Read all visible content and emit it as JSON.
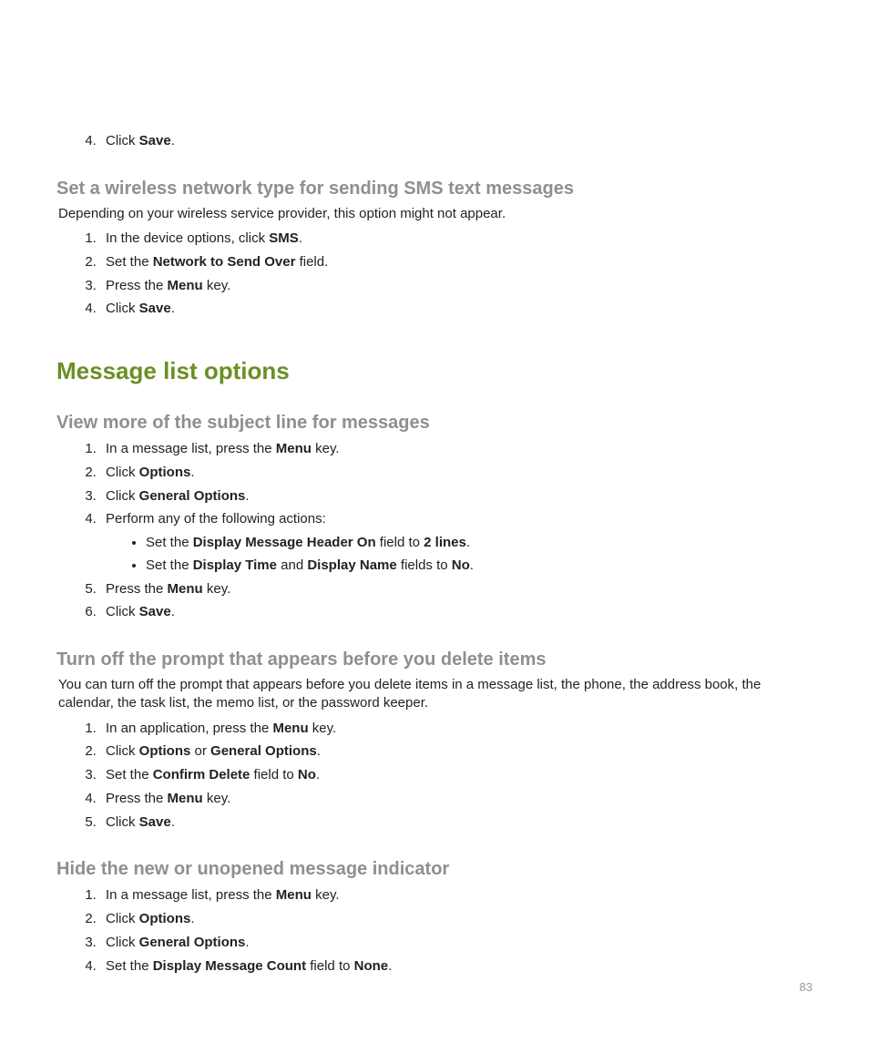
{
  "page_number": "83",
  "intro_step": {
    "num": "4",
    "pre": "Click ",
    "bold": "Save",
    "post": "."
  },
  "sec1": {
    "heading": "Set a wireless network type for sending SMS text messages",
    "lead": "Depending on your wireless service provider, this option might not appear.",
    "steps": [
      {
        "segs": [
          {
            "t": "In the device options, click "
          },
          {
            "t": "SMS",
            "b": true
          },
          {
            "t": "."
          }
        ]
      },
      {
        "segs": [
          {
            "t": "Set the "
          },
          {
            "t": "Network to Send Over",
            "b": true
          },
          {
            "t": " field."
          }
        ]
      },
      {
        "segs": [
          {
            "t": "Press the "
          },
          {
            "t": "Menu",
            "b": true
          },
          {
            "t": " key."
          }
        ]
      },
      {
        "segs": [
          {
            "t": "Click "
          },
          {
            "t": "Save",
            "b": true
          },
          {
            "t": "."
          }
        ]
      }
    ]
  },
  "section_title": "Message list options",
  "sec2": {
    "heading": "View more of the subject line for messages",
    "steps": [
      {
        "segs": [
          {
            "t": "In a message list, press the "
          },
          {
            "t": "Menu",
            "b": true
          },
          {
            "t": " key."
          }
        ]
      },
      {
        "segs": [
          {
            "t": "Click "
          },
          {
            "t": "Options",
            "b": true
          },
          {
            "t": "."
          }
        ]
      },
      {
        "segs": [
          {
            "t": "Click "
          },
          {
            "t": "General Options",
            "b": true
          },
          {
            "t": "."
          }
        ]
      },
      {
        "segs": [
          {
            "t": "Perform any of the following actions:"
          }
        ],
        "bullets": [
          {
            "segs": [
              {
                "t": "Set the "
              },
              {
                "t": "Display Message Header On",
                "b": true
              },
              {
                "t": " field to "
              },
              {
                "t": "2 lines",
                "b": true
              },
              {
                "t": "."
              }
            ]
          },
          {
            "segs": [
              {
                "t": "Set the "
              },
              {
                "t": "Display Time",
                "b": true
              },
              {
                "t": " and "
              },
              {
                "t": "Display Name",
                "b": true
              },
              {
                "t": " fields to "
              },
              {
                "t": "No",
                "b": true
              },
              {
                "t": "."
              }
            ]
          }
        ]
      },
      {
        "segs": [
          {
            "t": "Press the "
          },
          {
            "t": "Menu",
            "b": true
          },
          {
            "t": " key."
          }
        ]
      },
      {
        "segs": [
          {
            "t": "Click "
          },
          {
            "t": "Save",
            "b": true
          },
          {
            "t": "."
          }
        ]
      }
    ]
  },
  "sec3": {
    "heading": "Turn off the prompt that appears before you delete items",
    "lead": "You can turn off the prompt that appears before you delete items in a message list, the phone, the address book, the calendar, the task list, the memo list, or the password keeper.",
    "steps": [
      {
        "segs": [
          {
            "t": "In an application, press the "
          },
          {
            "t": "Menu",
            "b": true
          },
          {
            "t": " key."
          }
        ]
      },
      {
        "segs": [
          {
            "t": "Click "
          },
          {
            "t": "Options",
            "b": true
          },
          {
            "t": " or "
          },
          {
            "t": "General Options",
            "b": true
          },
          {
            "t": "."
          }
        ]
      },
      {
        "segs": [
          {
            "t": "Set the "
          },
          {
            "t": "Confirm Delete",
            "b": true
          },
          {
            "t": " field to "
          },
          {
            "t": "No",
            "b": true
          },
          {
            "t": "."
          }
        ]
      },
      {
        "segs": [
          {
            "t": "Press the "
          },
          {
            "t": "Menu",
            "b": true
          },
          {
            "t": " key."
          }
        ]
      },
      {
        "segs": [
          {
            "t": "Click "
          },
          {
            "t": "Save",
            "b": true
          },
          {
            "t": "."
          }
        ]
      }
    ]
  },
  "sec4": {
    "heading": "Hide the new or unopened message indicator",
    "steps": [
      {
        "segs": [
          {
            "t": "In a message list, press the "
          },
          {
            "t": "Menu",
            "b": true
          },
          {
            "t": " key."
          }
        ]
      },
      {
        "segs": [
          {
            "t": "Click "
          },
          {
            "t": "Options",
            "b": true
          },
          {
            "t": "."
          }
        ]
      },
      {
        "segs": [
          {
            "t": "Click "
          },
          {
            "t": "General Options",
            "b": true
          },
          {
            "t": "."
          }
        ]
      },
      {
        "segs": [
          {
            "t": "Set the "
          },
          {
            "t": "Display Message Count",
            "b": true
          },
          {
            "t": " field to "
          },
          {
            "t": "None",
            "b": true
          },
          {
            "t": "."
          }
        ]
      }
    ]
  }
}
